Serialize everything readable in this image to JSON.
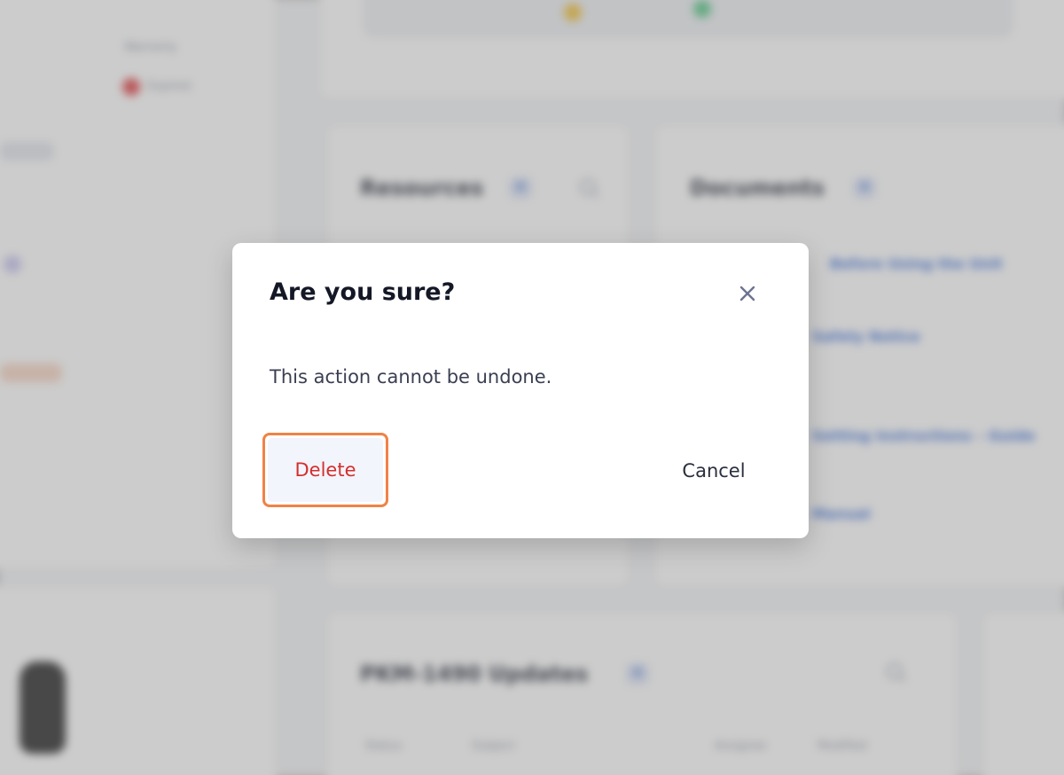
{
  "dialog": {
    "title": "Are you sure?",
    "message": "This action cannot be undone.",
    "delete_label": "Delete",
    "cancel_label": "Cancel",
    "close_icon": "close-icon"
  },
  "background": {
    "status_header": "Warranty",
    "status_value": "Expired",
    "resources_title": "Resources",
    "resources_count": "0",
    "documents_title": "Documents",
    "documents_count": "0",
    "updates_title": "PKM-1490 Updates",
    "updates_count": "0",
    "updates_columns": [
      "Status",
      "Subject",
      "Assignee",
      "Modified"
    ],
    "doc_links": [
      "Before Using the Unit",
      "Safety Notice",
      "Setting Instructions – Guide",
      "Manual"
    ]
  },
  "colors": {
    "accent_outline": "#f08246",
    "danger_text": "#d42e2e",
    "link": "#3b6fd8"
  }
}
